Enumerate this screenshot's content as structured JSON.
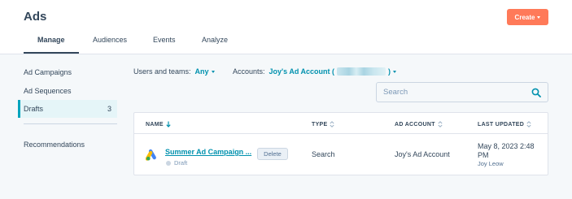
{
  "header": {
    "title": "Ads",
    "create_label": "Create",
    "tabs": [
      {
        "label": "Manage",
        "active": true
      },
      {
        "label": "Audiences",
        "active": false
      },
      {
        "label": "Events",
        "active": false
      },
      {
        "label": "Analyze",
        "active": false
      }
    ]
  },
  "sidebar": {
    "items": [
      {
        "label": "Ad Campaigns"
      },
      {
        "label": "Ad Sequences"
      },
      {
        "label": "Drafts",
        "count": "3",
        "active": true
      },
      {
        "label": "Recommendations"
      }
    ]
  },
  "filters": {
    "users_label": "Users and teams:",
    "users_value": "Any",
    "accounts_label": "Accounts:",
    "accounts_value": "Joy's Ad Account (",
    "accounts_close": ")"
  },
  "search": {
    "placeholder": "Search",
    "value": ""
  },
  "table": {
    "columns": [
      "NAME",
      "TYPE",
      "AD ACCOUNT",
      "LAST UPDATED"
    ],
    "rows": [
      {
        "name": "Summer Ad Campaign ...",
        "status": "Draft",
        "action": "Delete",
        "type": "Search",
        "ad_account": "Joy's Ad Account",
        "last_updated_line1": "May 8, 2023 2:48",
        "last_updated_line2": "PM",
        "updated_by": "Joy Leow",
        "platform_icon": "google-ads-icon"
      }
    ]
  },
  "colors": {
    "accent": "#0091ae",
    "create_button": "#ff7a59",
    "active_sidebar_bg": "#e5f5f8",
    "active_sidebar_border": "#00a4bd"
  }
}
